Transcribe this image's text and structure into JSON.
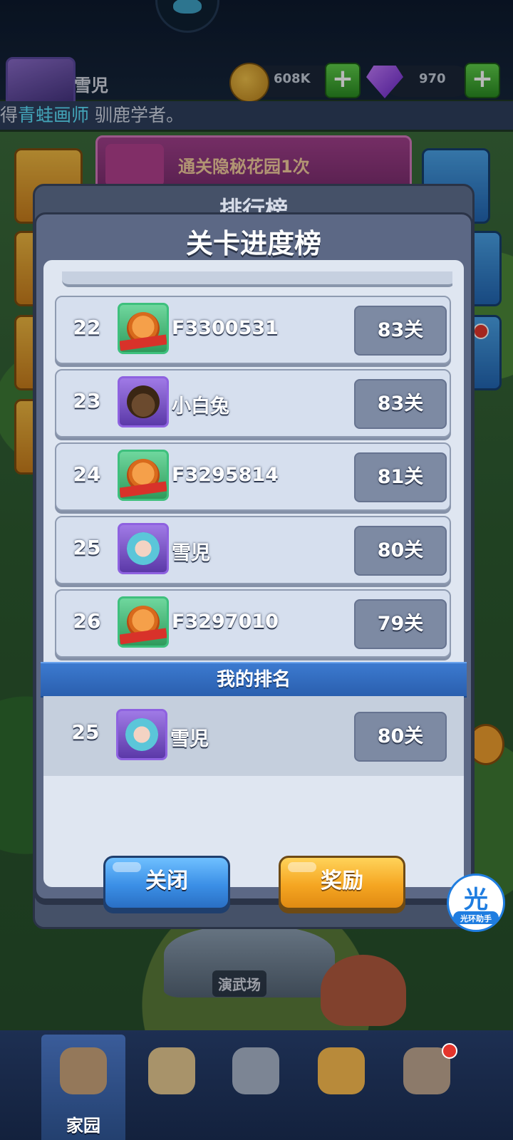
{
  "profile": {
    "name": "雪児"
  },
  "currency": {
    "coins": "608K",
    "gems": "970",
    "add_symbol": "+"
  },
  "announcement": {
    "prefix": "得",
    "highlight": "青蛙画师",
    "suffix": " 驯鹿学者。"
  },
  "quest": {
    "text": "通关隐秘花园1次"
  },
  "scene": {
    "arena_label": "演武场"
  },
  "back_dialog": {
    "title": "排行榜"
  },
  "dialog": {
    "title": "关卡进度榜",
    "rows": [
      {
        "rank": "22",
        "name": "F3300531",
        "level": "83关",
        "avatar": "tiger"
      },
      {
        "rank": "23",
        "name": "小白兔",
        "level": "83关",
        "avatar": "bird"
      },
      {
        "rank": "24",
        "name": "F3295814",
        "level": "81关",
        "avatar": "tiger"
      },
      {
        "rank": "25",
        "name": "雪児",
        "level": "80关",
        "avatar": "girl"
      },
      {
        "rank": "26",
        "name": "F3297010",
        "level": "79关",
        "avatar": "tiger"
      }
    ],
    "my_rank": {
      "header": "我的排名",
      "rank": "25",
      "name": "雪児",
      "level": "80关",
      "avatar": "girl"
    },
    "buttons": {
      "close": "关闭",
      "reward": "奖励"
    }
  },
  "helper": {
    "glyph": "光",
    "label": "光环助手"
  },
  "bottom_nav": {
    "home_label": "家园"
  }
}
